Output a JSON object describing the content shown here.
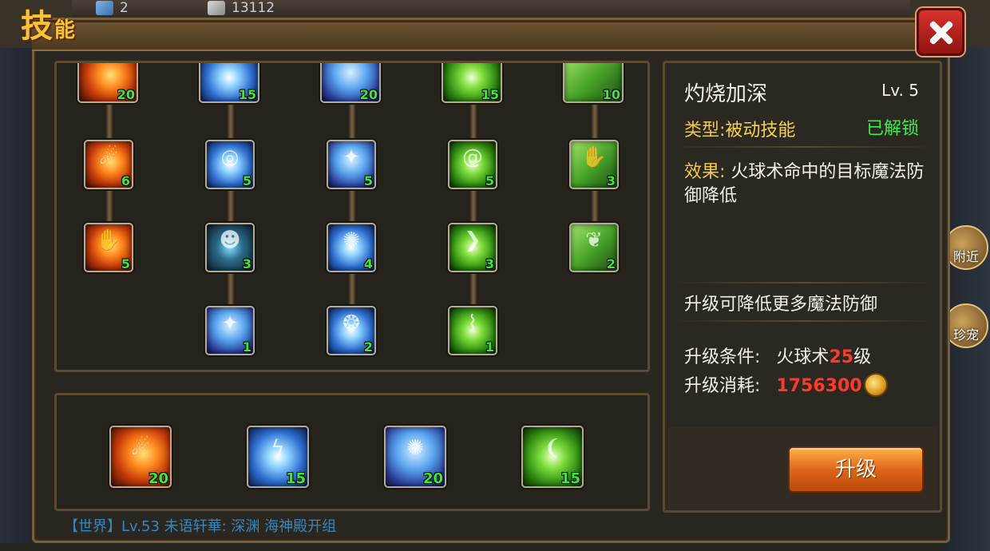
{
  "window": {
    "title_main": "技",
    "title_sub": "能",
    "close_icon": "close-icon"
  },
  "resources": {
    "gems": "2",
    "gold": "13112"
  },
  "tree": {
    "columns": [
      {
        "top": {
          "level": "20",
          "icon": "fireball-icon"
        },
        "row2": {
          "level": "6",
          "icon": "fire-streak-icon"
        },
        "row3": {
          "level": "5",
          "icon": "fire-hand-icon"
        },
        "row4": null
      },
      {
        "top": {
          "level": "15",
          "icon": "lightning-icon"
        },
        "row2": {
          "level": "5",
          "icon": "vortex-icon"
        },
        "row3": {
          "level": "3",
          "icon": "shadow-figure-icon"
        },
        "row4": {
          "level": "1",
          "icon": "ice-drop-icon"
        }
      },
      {
        "top": {
          "level": "20",
          "icon": "light-orb-icon"
        },
        "row2": {
          "level": "5",
          "icon": "ice-drop-icon"
        },
        "row3": {
          "level": "4",
          "icon": "energy-burst-icon"
        },
        "row4": {
          "level": "2",
          "icon": "rune-circle-icon"
        }
      },
      {
        "top": {
          "level": "15",
          "icon": "wind-slash-icon"
        },
        "row2": {
          "level": "5",
          "icon": "green-swirl-icon"
        },
        "row3": {
          "level": "3",
          "icon": "wind-blade-icon"
        },
        "row4": {
          "level": "1",
          "icon": "tornado-icon"
        }
      },
      {
        "top": {
          "level": "10",
          "icon": "nature-ward-icon"
        },
        "row2": {
          "level": "3",
          "icon": "nature-hand-icon"
        },
        "row3": {
          "level": "2",
          "icon": "leaf-icon"
        },
        "row4": null
      }
    ]
  },
  "equipped": [
    {
      "level": "20",
      "icon": "fireball-icon"
    },
    {
      "level": "15",
      "icon": "lightning-icon"
    },
    {
      "level": "20",
      "icon": "light-orb-icon"
    },
    {
      "level": "15",
      "icon": "wind-slash-icon"
    }
  ],
  "info": {
    "name": "灼烧加深",
    "level": "Lv. 5",
    "type_label": "类型:",
    "type_value": "被动技能",
    "status": "已解锁",
    "effect_label": "效果:",
    "effect_text": " 火球术命中的目标魔法防御降低",
    "upgrade_note": "升级可降低更多魔法防御",
    "cond_label": "升级条件:",
    "cond_skill": "火球术",
    "cond_level": "25",
    "cond_suffix": "级",
    "cost_label": "升级消耗:",
    "cost_value": "1756300",
    "cost_icon": "gold-coin-icon",
    "upgrade_button": "升级"
  },
  "side": {
    "nearby": "附近",
    "treasure": "珍宠"
  },
  "chat": {
    "line": "【世界】Lv.53 未语轩華: 深渊 海神殿开组"
  },
  "colors": {
    "title": "#f7c23a",
    "level_text": "#3ee83a",
    "unlocked": "#36f04a",
    "cost": "#ff3a2a",
    "type": "#f0c94a",
    "button": "#e0661a"
  }
}
